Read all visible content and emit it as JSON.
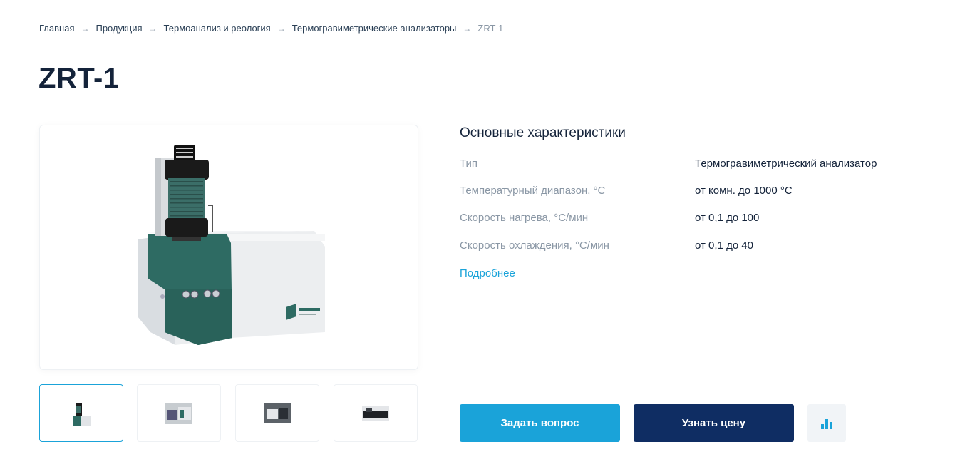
{
  "breadcrumb": {
    "items": [
      "Главная",
      "Продукция",
      "Термоанализ и реология",
      "Термогравиметрические анализаторы"
    ],
    "current": "ZRT-1"
  },
  "page": {
    "title": "ZRT-1"
  },
  "specs": {
    "title": "Основные характеристики",
    "rows": [
      {
        "label": "Тип",
        "value": "Термогравиметрический анализатор"
      },
      {
        "label": "Температурный диапазон, °С",
        "value": "от комн. до 1000 °С"
      },
      {
        "label": "Скорость нагрева, °С/мин",
        "value": "от 0,1 до 100"
      },
      {
        "label": "Скорость охлаждения, °С/мин",
        "value": "от 0,1 до 40"
      }
    ],
    "more_link": "Подробнее"
  },
  "actions": {
    "ask_label": "Задать вопрос",
    "price_label": "Узнать цену",
    "compare_icon": "bar-chart-icon"
  },
  "product_image": {
    "icon": "thermogravimetric-analyzer-image"
  },
  "colors": {
    "accent_blue": "#1aa3d9",
    "dark_navy": "#0f2d63",
    "instrument_green": "#2e6b63",
    "title_text": "#14233a",
    "muted_text": "#8a97a5"
  }
}
